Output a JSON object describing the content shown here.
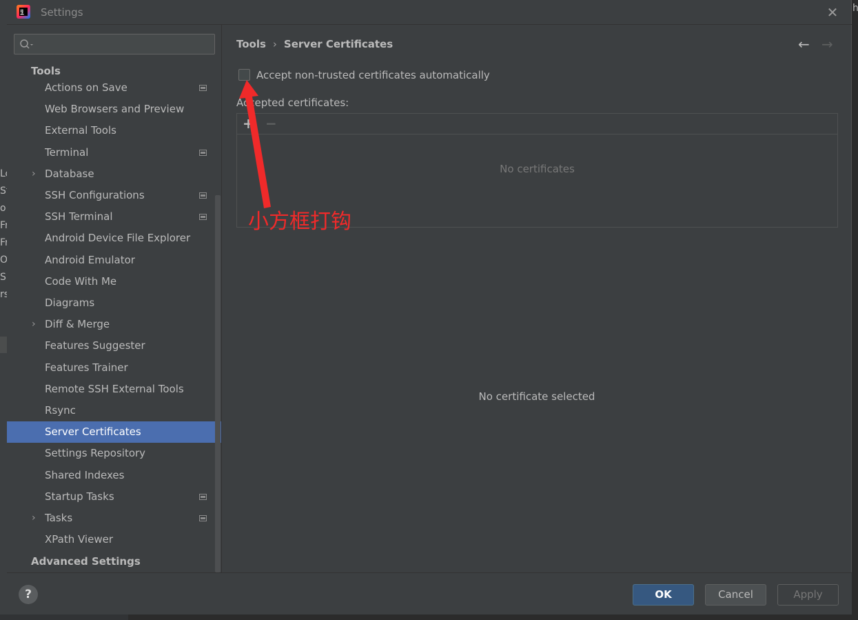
{
  "window": {
    "title": "Settings"
  },
  "background": {
    "letters": [
      "Lo",
      "St",
      "o",
      "Fr",
      "Fr",
      "O",
      "Sp",
      "rs"
    ],
    "right_edge": "h"
  },
  "search": {
    "placeholder": ""
  },
  "sidebar": {
    "section_tools": "Tools",
    "items": [
      {
        "label": "Actions on Save",
        "expandable": false,
        "project_level": true
      },
      {
        "label": "Web Browsers and Preview",
        "expandable": false,
        "project_level": false
      },
      {
        "label": "External Tools",
        "expandable": false,
        "project_level": false
      },
      {
        "label": "Terminal",
        "expandable": false,
        "project_level": true
      },
      {
        "label": "Database",
        "expandable": true,
        "project_level": false
      },
      {
        "label": "SSH Configurations",
        "expandable": false,
        "project_level": true
      },
      {
        "label": "SSH Terminal",
        "expandable": false,
        "project_level": true
      },
      {
        "label": "Android Device File Explorer",
        "expandable": false,
        "project_level": false
      },
      {
        "label": "Android Emulator",
        "expandable": false,
        "project_level": false
      },
      {
        "label": "Code With Me",
        "expandable": false,
        "project_level": false
      },
      {
        "label": "Diagrams",
        "expandable": false,
        "project_level": false
      },
      {
        "label": "Diff & Merge",
        "expandable": true,
        "project_level": false
      },
      {
        "label": "Features Suggester",
        "expandable": false,
        "project_level": false
      },
      {
        "label": "Features Trainer",
        "expandable": false,
        "project_level": false
      },
      {
        "label": "Remote SSH External Tools",
        "expandable": false,
        "project_level": false
      },
      {
        "label": "Rsync",
        "expandable": false,
        "project_level": false
      },
      {
        "label": "Server Certificates",
        "expandable": false,
        "project_level": false,
        "selected": true
      },
      {
        "label": "Settings Repository",
        "expandable": false,
        "project_level": false
      },
      {
        "label": "Shared Indexes",
        "expandable": false,
        "project_level": false
      },
      {
        "label": "Startup Tasks",
        "expandable": false,
        "project_level": true
      },
      {
        "label": "Tasks",
        "expandable": true,
        "project_level": true
      },
      {
        "label": "XPath Viewer",
        "expandable": false,
        "project_level": false
      }
    ],
    "section_advanced": "Advanced Settings"
  },
  "content": {
    "breadcrumb": {
      "parent": "Tools",
      "separator": "›",
      "current": "Server Certificates"
    },
    "accept_checkbox": {
      "label": "Accept non-trusted certificates automatically",
      "checked": false
    },
    "accepted_label": "Accepted certificates:",
    "toolbar": {
      "add": "+",
      "remove": "−"
    },
    "empty_list": "No certificates",
    "empty_detail": "No certificate selected"
  },
  "annotation": {
    "text": "小方框打钩",
    "color": "#f02a2a"
  },
  "footer": {
    "help": "?",
    "ok": "OK",
    "cancel": "Cancel",
    "apply": "Apply"
  },
  "colors": {
    "selection": "#4b6eaf",
    "ok_button": "#365880",
    "dialog_bg": "#3c3f41"
  }
}
